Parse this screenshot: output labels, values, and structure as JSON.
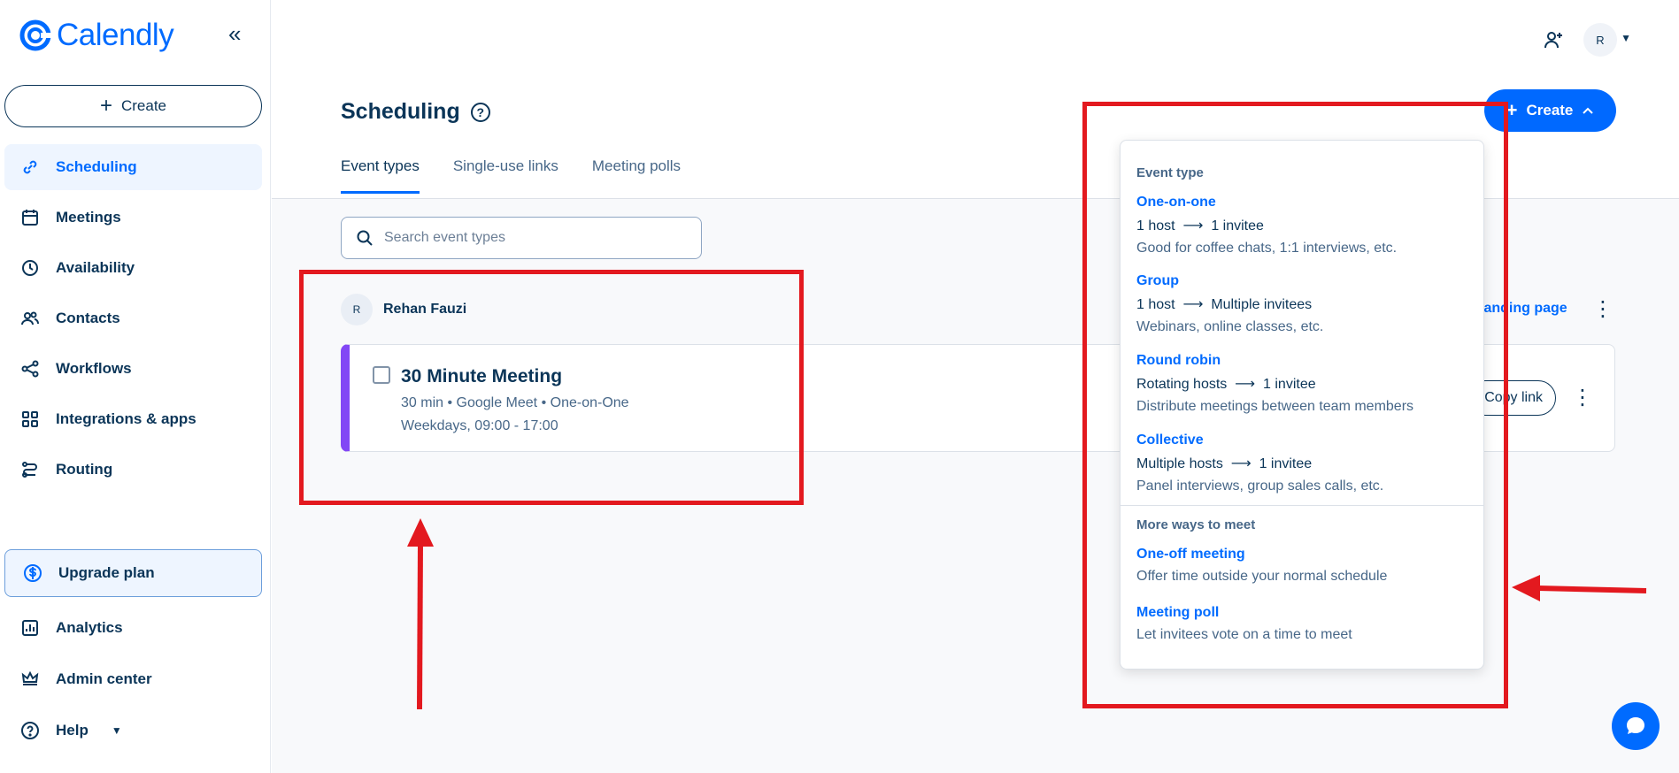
{
  "app": {
    "brand": "Calendly"
  },
  "sidebar": {
    "create_label": "Create",
    "items": [
      {
        "label": "Scheduling"
      },
      {
        "label": "Meetings"
      },
      {
        "label": "Availability"
      },
      {
        "label": "Contacts"
      },
      {
        "label": "Workflows"
      },
      {
        "label": "Integrations & apps"
      },
      {
        "label": "Routing"
      }
    ],
    "upgrade_label": "Upgrade plan",
    "bottom_items": [
      {
        "label": "Analytics"
      },
      {
        "label": "Admin center"
      },
      {
        "label": "Help"
      }
    ]
  },
  "header": {
    "avatar_initial": "R"
  },
  "page": {
    "title": "Scheduling",
    "tabs": [
      "Event types",
      "Single-use links",
      "Meeting polls"
    ],
    "search_placeholder": "Search event types",
    "create_label": "Create"
  },
  "user": {
    "initial": "R",
    "name": "Rehan Fauzi",
    "landing_label": "landing page"
  },
  "event": {
    "title": "30 Minute Meeting",
    "meta": "30 min • Google Meet • One-on-One",
    "hours": "Weekdays, 09:00 - 17:00",
    "copy_label": "Copy link"
  },
  "dropdown": {
    "section1": "Event type",
    "items": [
      {
        "title": "One-on-one",
        "from": "1 host",
        "to": "1 invitee",
        "desc": "Good for coffee chats, 1:1 interviews, etc."
      },
      {
        "title": "Group",
        "from": "1 host",
        "to": "Multiple invitees",
        "desc": "Webinars, online classes, etc."
      },
      {
        "title": "Round robin",
        "from": "Rotating hosts",
        "to": "1 invitee",
        "desc": "Distribute meetings between team members"
      },
      {
        "title": "Collective",
        "from": "Multiple hosts",
        "to": "1 invitee",
        "desc": "Panel interviews, group sales calls, etc."
      }
    ],
    "section2": "More ways to meet",
    "more": [
      {
        "title": "One-off meeting",
        "desc": "Offer time outside your normal schedule"
      },
      {
        "title": "Meeting poll",
        "desc": "Let invitees vote on a time to meet"
      }
    ]
  },
  "colors": {
    "accent": "#006bff",
    "annotation": "#e3191f",
    "event_stripe": "#8247f5"
  }
}
